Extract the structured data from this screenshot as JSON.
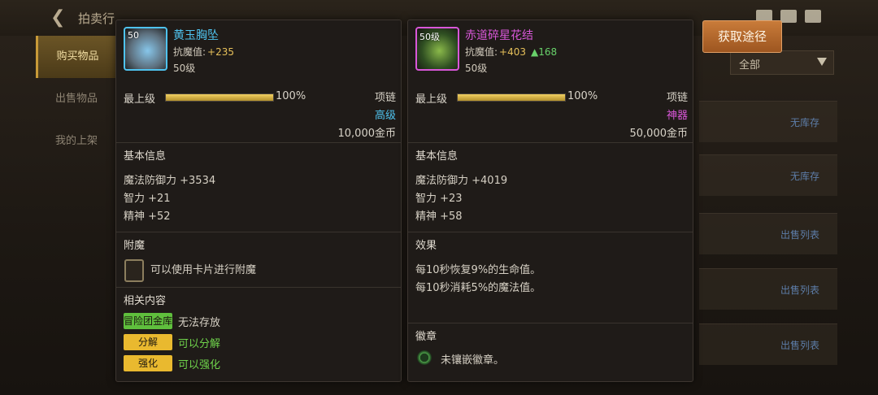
{
  "background": {
    "title": "拍卖行",
    "sidebar": [
      "购买物品",
      "出售物品",
      "我的上架"
    ],
    "filter": "全部",
    "rows": [
      "无库存",
      "无库存",
      "出售列表",
      "出售列表",
      "出售列表"
    ]
  },
  "get_button_label": "获取途径",
  "items": [
    {
      "level_badge": "50",
      "name": "黄玉胸坠",
      "name_color": "#4fc3ef",
      "stat_label": "抗魔值:",
      "stat_value": "+235",
      "stat_extra": "",
      "level": "50级",
      "grade_label": "最上级",
      "grade_percent": "100%",
      "grade_fraction": 1.0,
      "slot": "项链",
      "rarity": "高级",
      "rarity_color": "#4fc3ef",
      "price": "10,000金币",
      "basic_title": "基本信息",
      "basic_stats": [
        "魔法防御力 +3534",
        "智力 +21",
        "精神 +52"
      ],
      "enchant_title": "附魔",
      "enchant_text": "可以使用卡片进行附魔",
      "related_title": "相关内容",
      "related": [
        {
          "tag": "冒险团金库",
          "text": "无法存放",
          "tag_color": "#5fbf3d",
          "text_color": "#d6d0c4"
        },
        {
          "tag": "分解",
          "text": "可以分解",
          "tag_color": "#e9b92f",
          "text_color": "#6fd34b"
        },
        {
          "tag": "强化",
          "text": "可以强化",
          "tag_color": "#e9b92f",
          "text_color": "#6fd34b"
        }
      ],
      "icon_colors": [
        "#5d6f7d",
        "#87c6ea"
      ]
    },
    {
      "level_badge": "50级",
      "name": "赤道碎星花结",
      "name_color": "#d957d9",
      "stat_label": "抗魔值:",
      "stat_value": "+403",
      "stat_extra": "▲168",
      "level": "50级",
      "grade_label": "最上级",
      "grade_percent": "100%",
      "grade_fraction": 1.0,
      "slot": "项链",
      "rarity": "神器",
      "rarity_color": "#d957d9",
      "price": "50,000金币",
      "basic_title": "基本信息",
      "basic_stats": [
        "魔法防御力 +4019",
        "智力 +23",
        "精神 +58"
      ],
      "effect_title": "效果",
      "effects": [
        "每10秒恢复9%的生命值。",
        "每10秒消耗5%的魔法值。"
      ],
      "badge_title": "徽章",
      "badge_text": "未镶嵌徽章。",
      "icon_colors": [
        "#2f4f22",
        "#8ab94a"
      ]
    }
  ]
}
